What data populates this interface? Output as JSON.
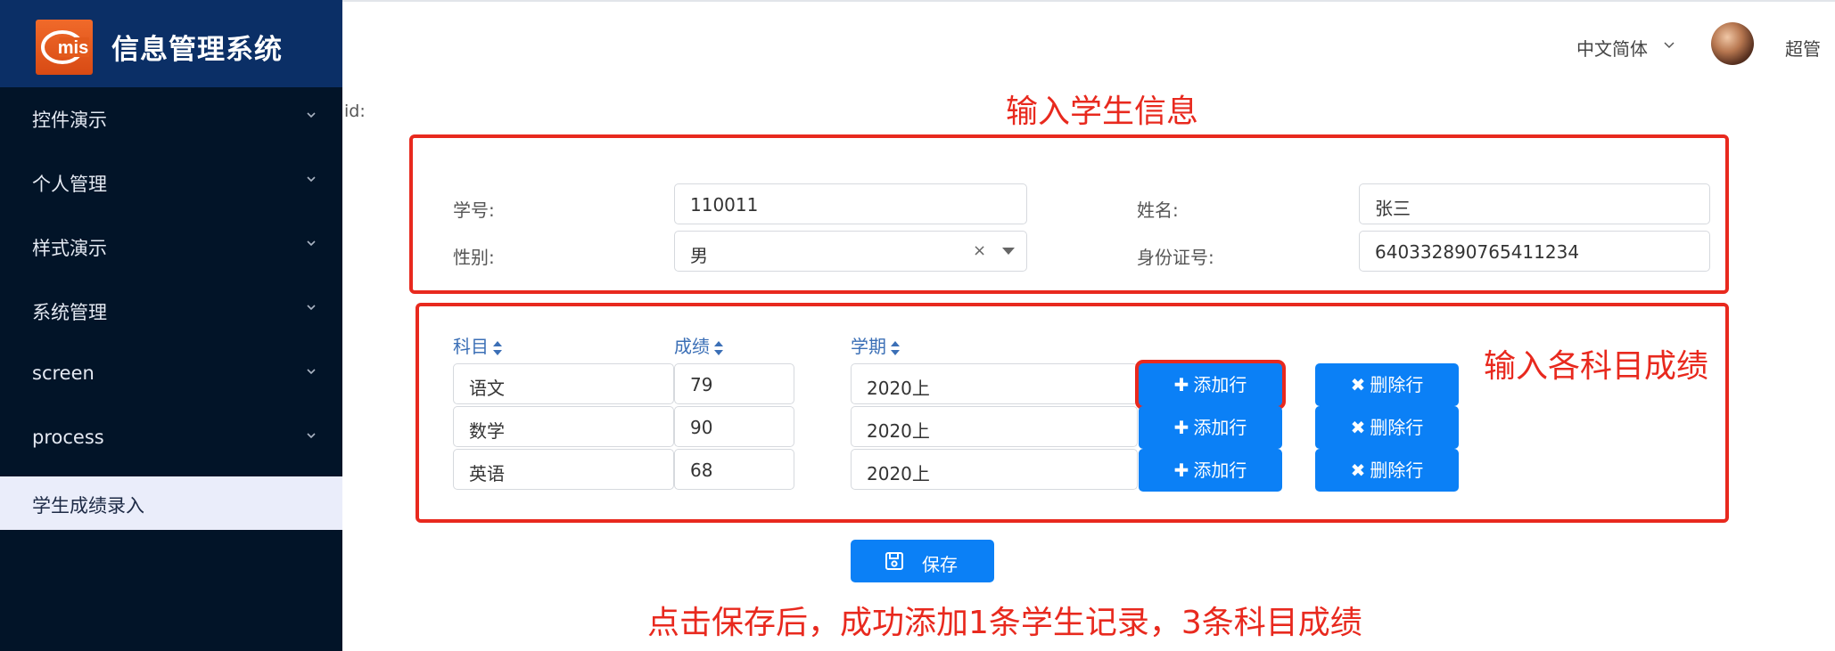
{
  "sidebar": {
    "brand_title": "信息管理系统",
    "logo_text": "mis",
    "items": [
      {
        "label": "控件演示"
      },
      {
        "label": "个人管理"
      },
      {
        "label": "样式演示"
      },
      {
        "label": "系统管理"
      },
      {
        "label": "screen"
      },
      {
        "label": "process"
      },
      {
        "label": "学生成绩录入",
        "active": true
      }
    ]
  },
  "header": {
    "language": "中文简体",
    "user_name": "超管"
  },
  "form": {
    "id_label": "id:",
    "student_no_label": "学号:",
    "student_no": "110011",
    "name_label": "姓名:",
    "name": "张三",
    "gender_label": "性别:",
    "gender": "男",
    "id_card_label": "身份证号:",
    "id_card": "640332890765411234"
  },
  "table": {
    "columns": [
      "科目",
      "成绩",
      "学期"
    ],
    "rows": [
      {
        "subject": "语文",
        "score": "79",
        "term": "2020上"
      },
      {
        "subject": "数学",
        "score": "90",
        "term": "2020上"
      },
      {
        "subject": "英语",
        "score": "68",
        "term": "2020上"
      }
    ],
    "add_label": "添加行",
    "delete_label": "删除行"
  },
  "save_label": "保存",
  "annotations": {
    "title": "输入学生信息",
    "right": "输入各科目成绩",
    "bottom": "点击保存后，成功添加1条学生记录，3条科目成绩"
  },
  "colors": {
    "sidebar_bg": "#021428",
    "brand_bg": "#0b2f66",
    "accent": "#0b80f6",
    "annotation_red": "#e8291e",
    "active_menu_bg": "#eaedfa"
  }
}
